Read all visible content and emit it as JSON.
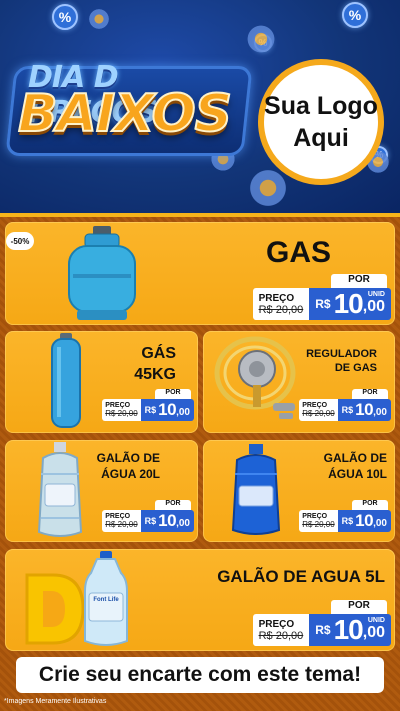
{
  "header": {
    "title_line1": "DIA D PREÇOS",
    "title_line2": "BAIXOS",
    "logo_line1": "Sua Logo",
    "logo_line2": "Aqui",
    "badge_symbol": "%"
  },
  "discount_badge": "-50%",
  "products": [
    {
      "name": "GAS",
      "label_old": "PREÇO",
      "old_price": "R$ 20,00",
      "por": "POR",
      "currency": "R$",
      "price_int": "10",
      "price_dec": ",00",
      "unit": "UNID"
    },
    {
      "name_line1": "GÁS",
      "name_line2": "45KG",
      "label_old": "PREÇO",
      "old_price": "R$ 20,00",
      "por": "POR",
      "currency": "R$",
      "price_int": "10",
      "price_dec": ",00"
    },
    {
      "name_line1": "REGULADOR",
      "name_line2": "DE GAS",
      "label_old": "PREÇO",
      "old_price": "R$ 20,00",
      "por": "POR",
      "currency": "R$",
      "price_int": "10",
      "price_dec": ",00"
    },
    {
      "name_line1": "GALÃO DE",
      "name_line2": "ÁGUA 20L",
      "label_old": "PREÇO",
      "old_price": "R$ 20,00",
      "por": "POR",
      "currency": "R$",
      "price_int": "10",
      "price_dec": ",00"
    },
    {
      "name_line1": "GALÃO DE",
      "name_line2": "ÁGUA 10L",
      "label_old": "PREÇO",
      "old_price": "R$ 20,00",
      "por": "POR",
      "currency": "R$",
      "price_int": "10",
      "price_dec": ",00"
    },
    {
      "name": "GALÃO DE AGUA 5L",
      "label_old": "PREÇO",
      "old_price": "R$ 20,00",
      "por": "POR",
      "currency": "R$",
      "price_int": "10",
      "price_dec": ",00",
      "unit": "UNID"
    }
  ],
  "water_brand": "Font Life",
  "footer": {
    "cta": "Crie seu encarte com este tema!",
    "disclaimer": "*Imagens Meramente Ilustrativas"
  },
  "colors": {
    "header_bg": "#123578",
    "card_orange": "#f6a815",
    "price_blue": "#2a5fd0",
    "title_orange": "#f8a51d"
  }
}
